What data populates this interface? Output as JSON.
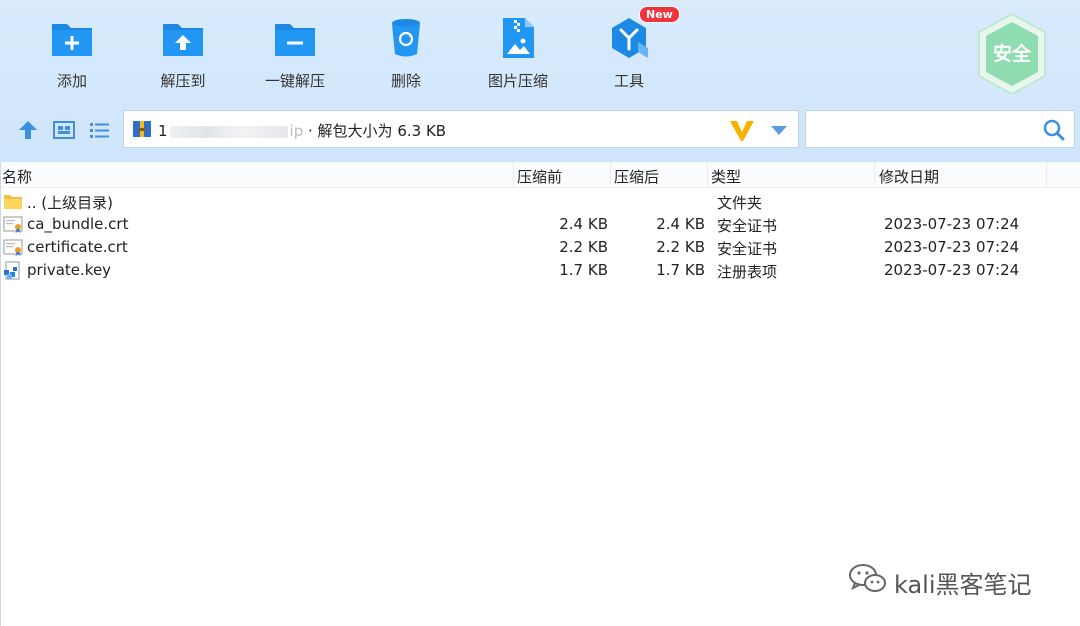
{
  "toolbar": {
    "add_label": "添加",
    "extract_to_label": "解压到",
    "one_click_extract_label": "一键解压",
    "delete_label": "删除",
    "image_compress_label": "图片压缩",
    "tools_label": "工具",
    "tools_badge": "New",
    "security_label": "安全"
  },
  "path": {
    "prefix": "1",
    "suffix_fragment": "ip",
    "info": " · 解包大小为 6.3 KB"
  },
  "search": {
    "value": ""
  },
  "columns": {
    "name": "名称",
    "compressed_before": "压缩前",
    "compressed_after": "压缩后",
    "type": "类型",
    "modified": "修改日期"
  },
  "rows": [
    {
      "name": ".. (上级目录)",
      "before": "",
      "after": "",
      "type": "文件夹",
      "modified": "",
      "icon": "folder-icon"
    },
    {
      "name": "ca_bundle.crt",
      "before": "2.4 KB",
      "after": "2.4 KB",
      "type": "安全证书",
      "modified": "2023-07-23 07:24",
      "icon": "certificate-icon"
    },
    {
      "name": "certificate.crt",
      "before": "2.2 KB",
      "after": "2.2 KB",
      "type": "安全证书",
      "modified": "2023-07-23 07:24",
      "icon": "certificate-icon"
    },
    {
      "name": "private.key",
      "before": "1.7 KB",
      "after": "1.7 KB",
      "type": "注册表项",
      "modified": "2023-07-23 07:24",
      "icon": "registry-icon"
    }
  ],
  "watermark": {
    "text": "kali黑客笔记"
  },
  "colors": {
    "accent": "#1e88e5",
    "toolbar_bg": "#d4e8fc",
    "badge": "#f0343d",
    "shield": "#7ed6a4"
  }
}
